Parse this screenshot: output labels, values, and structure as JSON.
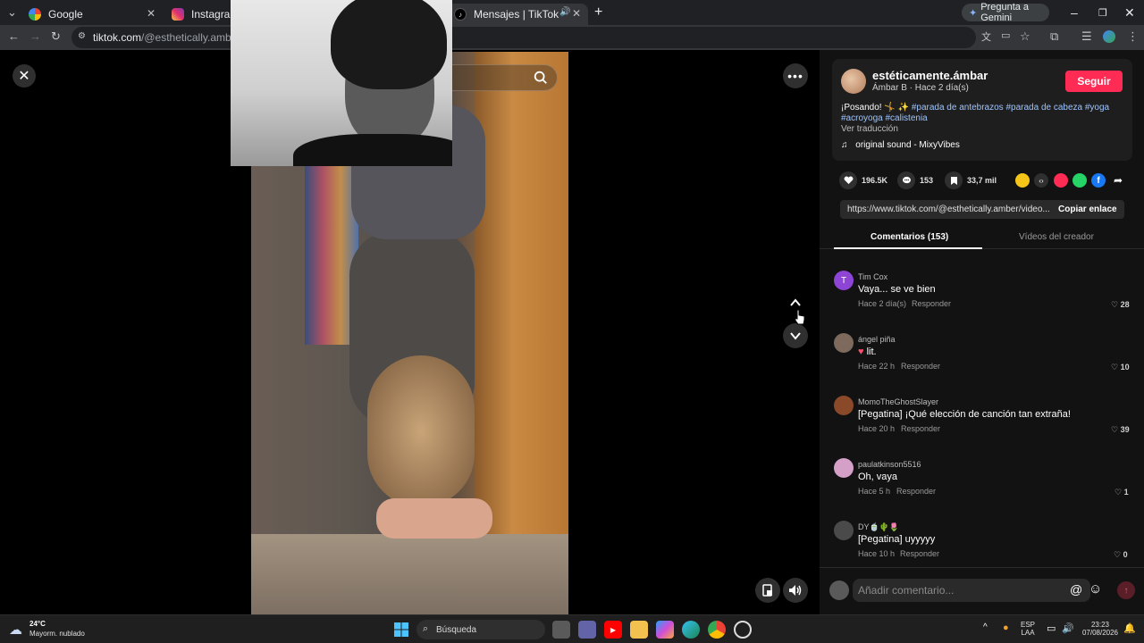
{
  "browser": {
    "tabs": [
      {
        "label": "Google",
        "active": false
      },
      {
        "label": "Instagram",
        "active": false
      },
      {
        "label": "Mensajes | TikTok",
        "active": true
      }
    ],
    "gemini_label": "Pregunta a Gemini",
    "url_host": "tiktok.com",
    "url_path": "/@esthetically.amber/video/"
  },
  "author": {
    "name": "estéticamente.ámbar",
    "sub": "Ámbar B · Hace 2 día(s)",
    "follow_label": "Seguir"
  },
  "post": {
    "caption_lead": "¡Posando! 🤸 ✨",
    "hashtags": [
      "#parada de antebrazos",
      "#parada de cabeza",
      "#yoga",
      "#acroyoga",
      "#calistenia"
    ],
    "translate_label": "Ver traducción",
    "sound": "original sound - MixyVibes"
  },
  "stats": {
    "likes": "196.5K",
    "comments": "153",
    "saves": "33,7 mil"
  },
  "share": {
    "link": "https://www.tiktok.com/@esthetically.amber/video...",
    "copy_label": "Copiar enlace"
  },
  "panel_tabs": {
    "comments": "Comentarios (153)",
    "creator_videos": "Vídeos del creador"
  },
  "comments": [
    {
      "user": "Tim Cox",
      "text": "Vaya... se ve bien",
      "time": "Hace 2 día(s)",
      "reply": "Responder",
      "likes": "28",
      "avatar_letter": "T",
      "avatar_color": "#8e44d4"
    },
    {
      "user": "ángel piña",
      "text": "lit.",
      "time": "Hace 22 h",
      "reply": "Responder",
      "likes": "10",
      "avatar_letter": "",
      "avatar_color": "#7d6a5c"
    },
    {
      "user": "MomoTheGhostSlayer",
      "text": "[Pegatina] ¡Qué elección de canción tan extraña!",
      "time": "Hace 20 h",
      "reply": "Responder",
      "likes": "39",
      "avatar_letter": "",
      "avatar_color": "#8a4a2a"
    },
    {
      "user": "paulatkinson5516",
      "text": "Oh, vaya",
      "time": "Hace 5 h",
      "reply": "Responder",
      "likes": "1",
      "avatar_letter": "",
      "avatar_color": "#d4a0c8"
    },
    {
      "user": "DY🍵🌵🌷",
      "text": "[Pegatina] uyyyyy",
      "time": "Hace 10 h",
      "reply": "Responder",
      "likes": "0",
      "avatar_letter": "",
      "avatar_color": "#4a4a4a"
    }
  ],
  "comment_input": {
    "placeholder": "Añadir comentario..."
  },
  "taskbar": {
    "weather_temp": "24°C",
    "weather_desc": "Mayorm. nublado",
    "search_label": "Búsqueda",
    "lang_line1": "ESP",
    "lang_line2": "LAA",
    "time": "23:23",
    "date": "07/08/2026"
  },
  "colors": {
    "accent": "#fe2c55",
    "hashtag": "#9cc4ff",
    "panel_bg": "#121212"
  }
}
